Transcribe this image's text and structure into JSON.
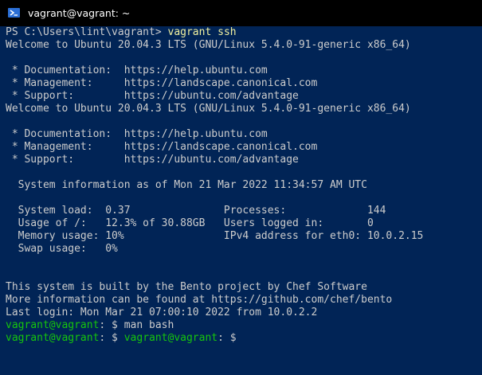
{
  "window": {
    "title": "vagrant@vagrant: ~",
    "icon": "powershell-icon"
  },
  "colors": {
    "background": "#012456",
    "text": "#cccccc",
    "command": "#f2f2a0",
    "prompt": "#16c60c"
  },
  "console": {
    "ps_prompt": "PS C:\\Users\\lint\\vagrant> ",
    "ps_command": "vagrant ssh",
    "lines": [
      "Welcome to Ubuntu 20.04.3 LTS (GNU/Linux 5.4.0-91-generic x86_64)",
      "",
      " * Documentation:  https://help.ubuntu.com",
      " * Management:     https://landscape.canonical.com",
      " * Support:        https://ubuntu.com/advantage",
      "Welcome to Ubuntu 20.04.3 LTS (GNU/Linux 5.4.0-91-generic x86_64)",
      "",
      " * Documentation:  https://help.ubuntu.com",
      " * Management:     https://landscape.canonical.com",
      " * Support:        https://ubuntu.com/advantage",
      "",
      "  System information as of Mon 21 Mar 2022 11:34:57 AM UTC",
      "",
      "  System load:  0.37               Processes:             144",
      "  Usage of /:   12.3% of 30.88GB   Users logged in:       0",
      "  Memory usage: 10%                IPv4 address for eth0: 10.0.2.15",
      "  Swap usage:   0%",
      "",
      "",
      "This system is built by the Bento project by Chef Software",
      "More information can be found at https://github.com/chef/bento",
      "Last login: Mon Mar 21 07:00:10 2022 from 10.0.2.2"
    ],
    "bash_prompt_host": "vagrant@vagrant",
    "bash_prompt_suffix": ": $ ",
    "bash_command_1": "man bash",
    "bash_command_2": "vagrant@vagrant",
    "bash_tail_2": ": $"
  }
}
